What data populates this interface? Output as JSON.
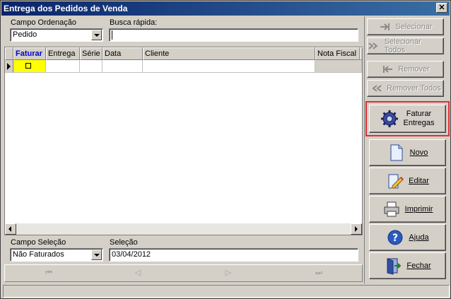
{
  "window": {
    "title": "Entrega dos Pedidos de Venda",
    "close_glyph": "✕"
  },
  "filters": {
    "order_label": "Campo Ordenação",
    "order_value": "Pedido",
    "search_label": "Busca rápida:",
    "search_value": "",
    "selection_field_label": "Campo Seleção",
    "selection_field_value": "Não Faturados",
    "selection_label": "Seleção",
    "selection_value": "03/04/2012"
  },
  "grid": {
    "columns": [
      "Faturar",
      "Entrega",
      "Série",
      "Data",
      "Cliente",
      "Nota Fiscal"
    ],
    "rows": [
      [
        "",
        "",
        "",
        "",
        "",
        ""
      ]
    ]
  },
  "side_buttons": {
    "select": "Selecionar",
    "select_all": "Selecionar Todos",
    "remove": "Remover",
    "remove_all": "Remover Todos",
    "invoice_line1": "Faturar",
    "invoice_line2": "Entregas",
    "new": "Novo",
    "edit": "Editar",
    "print": "Imprimir",
    "help": "Ajuda",
    "close": "Fechar"
  },
  "icons": {
    "select": "add-arrow-icon",
    "select_all": "double-arrow-icon",
    "remove": "remove-arrow-icon",
    "remove_all": "double-left-arrow-icon",
    "invoice": "gears-icon",
    "new": "new-document-icon",
    "edit": "edit-pencil-icon",
    "print": "printer-icon",
    "help": "help-icon",
    "close": "exit-door-icon"
  },
  "colors": {
    "titlebar": "#0a246a",
    "highlight": "#e03030",
    "active_cell": "#ffff00"
  }
}
